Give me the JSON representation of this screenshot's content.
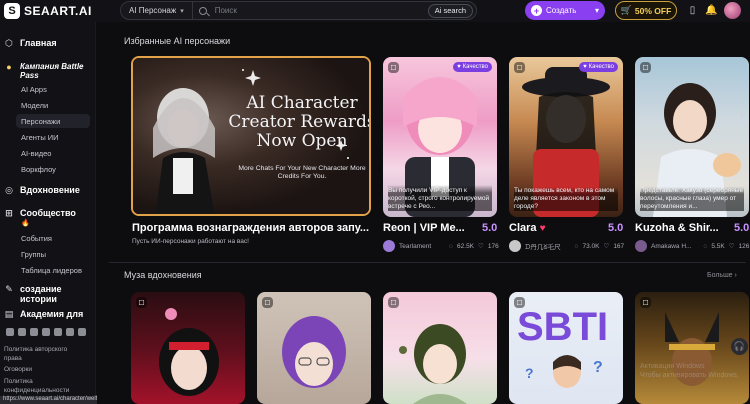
{
  "header": {
    "logo_text": "SEAART.AI",
    "search_type": "AI Персонаж",
    "search_placeholder": "Поиск",
    "ai_search_label": "Ai search",
    "create_label": "Создать",
    "promo_label": "50% OFF"
  },
  "sidebar": {
    "home": "Главная",
    "battle_pass": "Кампания Battle Pass",
    "items": [
      "AI Apps",
      "Модели",
      "Персонажи",
      "Агенты ИИ",
      "AI-видео",
      "Воркфлоу"
    ],
    "inspiration": "Вдохновение",
    "community": "Сообщество",
    "community_items": [
      "События",
      "Группы",
      "Таблица лидеров"
    ],
    "create_stories": "создание истории",
    "academy": "Академия для",
    "links": [
      "Политика авторского права",
      "Оговорки",
      "Политика конфиденциальности"
    ],
    "url": "https://www.seaart.ai/character/welfare"
  },
  "featured": {
    "section_title": "Избранные AI персонажи",
    "banner": {
      "headline": "AI Character Creator Rewards Now Open",
      "subline": "More Chats For Your New Character More Credits For You.",
      "title": "Программа вознаграждения авторов запу...",
      "subtitle": "Пусть ИИ-персонажи работают на вас!"
    },
    "cards": [
      {
        "title": "Reon | VIP Me...",
        "score": "5.0",
        "badge": "Качество",
        "overlay": "Вы получили VIP-доступ к короткой, строго контролируемой встрече с Рео...",
        "author": "Tearlament",
        "chats": "62.5K",
        "likes": "176"
      },
      {
        "title": "Clara",
        "score": "5.0",
        "badge": "Качество",
        "overlay": "Ты покажешь всем, кто на самом деле является законом в этом городе?",
        "author": "ᗪ丹几ᘜ乇尺",
        "chats": "73.0K",
        "likes": "167"
      },
      {
        "title": "Kuzoha & Shir...",
        "score": "5.0",
        "badge": "",
        "overlay": "Представьте: Хакузо (серебряные волосы, красные глаза) умер от переутомления и...",
        "author": "Amakawa H...",
        "chats": "5.5K",
        "likes": "126"
      }
    ]
  },
  "muse": {
    "section_title": "Муза вдохновения",
    "more_label": "Больше",
    "card_count": 5
  },
  "watermark": [
    "Активация Windows",
    "Чтобы активировать Windows,"
  ],
  "colors": {
    "accent": "#8a3ff1",
    "score": "#c892ff",
    "promo": "#f4cf5a",
    "banner_border": "#e2a24a"
  }
}
